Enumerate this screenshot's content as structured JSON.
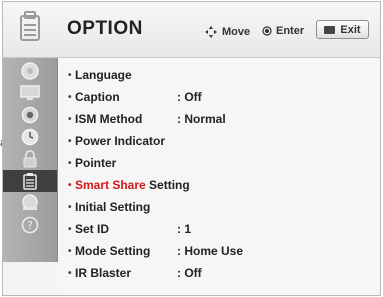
{
  "header": {
    "title": "OPTION",
    "move_label": "Move",
    "enter_label": "Enter",
    "exit_label": "Exit"
  },
  "sidebar": {
    "items": [
      {
        "icon": "picture-icon"
      },
      {
        "icon": "screen-icon"
      },
      {
        "icon": "audio-icon"
      },
      {
        "icon": "time-icon"
      },
      {
        "icon": "lock-icon"
      },
      {
        "icon": "option-icon",
        "active": true
      },
      {
        "icon": "network-icon"
      },
      {
        "icon": "help-icon"
      }
    ]
  },
  "menu": {
    "items": [
      {
        "label": "Language",
        "value": ""
      },
      {
        "label": "Caption",
        "value": ": Off"
      },
      {
        "label": "ISM Method",
        "value": ": Normal"
      },
      {
        "label": "Power Indicator",
        "value": ""
      },
      {
        "label": "Pointer",
        "value": ""
      },
      {
        "label_red": "Smart Share",
        "label_rest": " Setting",
        "value": ""
      },
      {
        "label": "Initial Setting",
        "value": ""
      },
      {
        "label": "Set ID",
        "value": ": 1"
      },
      {
        "label": "Mode Setting",
        "value": ": Home Use"
      },
      {
        "label": "IR Blaster",
        "value": ": Off"
      }
    ]
  },
  "edge_text": "a.",
  "colors": {
    "highlight": "#d01a1a",
    "active_sidebar": "#3f3f3f"
  }
}
